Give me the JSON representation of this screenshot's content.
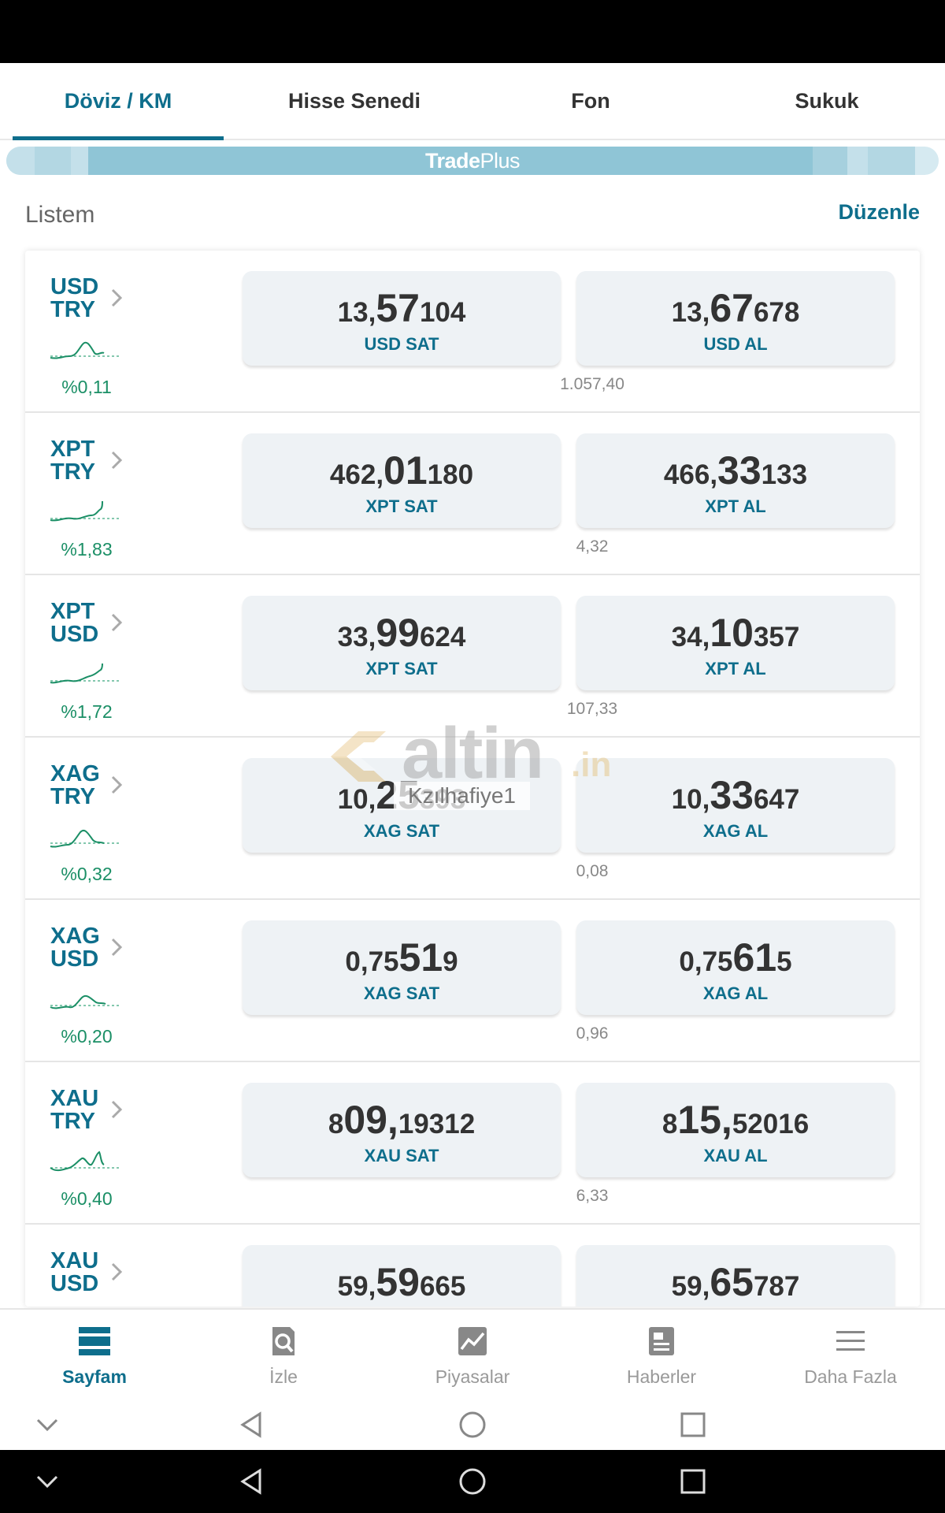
{
  "tabs": [
    {
      "label": "Döviz / KM",
      "active": true
    },
    {
      "label": "Hisse Senedi",
      "active": false
    },
    {
      "label": "Fon",
      "active": false
    },
    {
      "label": "Sukuk",
      "active": false
    }
  ],
  "banner": {
    "label_bold": "Trade",
    "label_rest": "Plus"
  },
  "section": {
    "title": "Listem",
    "edit_label": "Düzenle"
  },
  "colors": {
    "accent": "#0e6e8c",
    "positive": "#1b8f66",
    "card_bg": "#eef2f5"
  },
  "rows": [
    {
      "base": "USD",
      "quote": "TRY",
      "change": "%0,11",
      "sell": {
        "p1": "13,",
        "p2": "57",
        "p3": "104",
        "label": "USD SAT"
      },
      "buy": {
        "p1": "13,",
        "p2": "67",
        "p3": "678",
        "label": "USD AL"
      },
      "spread": "1.057,40"
    },
    {
      "base": "XPT",
      "quote": "TRY",
      "change": "%1,83",
      "sell": {
        "p1": "462,",
        "p2": "01",
        "p3": "180",
        "label": "XPT SAT"
      },
      "buy": {
        "p1": "466,",
        "p2": "33",
        "p3": "133",
        "label": "XPT AL"
      },
      "spread": "4,32"
    },
    {
      "base": "XPT",
      "quote": "USD",
      "change": "%1,72",
      "sell": {
        "p1": "33,",
        "p2": "99",
        "p3": "624",
        "label": "XPT SAT"
      },
      "buy": {
        "p1": "34,",
        "p2": "10",
        "p3": "357",
        "label": "XPT AL"
      },
      "spread": "107,33"
    },
    {
      "base": "XAG",
      "quote": "TRY",
      "change": "%0,32",
      "sell": {
        "p1": "10,",
        "p2": "25",
        "p3": "393",
        "label": "XAG SAT"
      },
      "buy": {
        "p1": "10,",
        "p2": "33",
        "p3": "647",
        "label": "XAG AL"
      },
      "spread": "0,08"
    },
    {
      "base": "XAG",
      "quote": "USD",
      "change": "%0,20",
      "sell": {
        "p1": "0,75",
        "p2": "51",
        "p3": "9",
        "label": "XAG SAT"
      },
      "buy": {
        "p1": "0,75",
        "p2": "61",
        "p3": "5",
        "label": "XAG AL"
      },
      "spread": "0,96"
    },
    {
      "base": "XAU",
      "quote": "TRY",
      "change": "%0,40",
      "sell": {
        "p1": "8",
        "p2": "09,",
        "p3": "19312",
        "label": "XAU SAT"
      },
      "buy": {
        "p1": "8",
        "p2": "15,",
        "p3": "52016",
        "label": "XAU AL"
      },
      "spread": "6,33"
    },
    {
      "base": "XAU",
      "quote": "USD",
      "change": "",
      "sell": {
        "p1": "59,",
        "p2": "59",
        "p3": "665",
        "label": ""
      },
      "buy": {
        "p1": "59,",
        "p2": "65",
        "p3": "787",
        "label": ""
      },
      "spread": ""
    }
  ],
  "watermark": {
    "brand": "altin",
    "suffix": ".in",
    "user": "Kzılhafiye1"
  },
  "bottom_nav": [
    {
      "label": "Sayfam",
      "icon": "page-icon",
      "active": true
    },
    {
      "label": "İzle",
      "icon": "watch-search-icon",
      "active": false
    },
    {
      "label": "Piyasalar",
      "icon": "markets-chart-icon",
      "active": false
    },
    {
      "label": "Haberler",
      "icon": "news-icon",
      "active": false
    },
    {
      "label": "Daha Fazla",
      "icon": "menu-icon",
      "active": false
    }
  ],
  "system_nav": {
    "icons": [
      "chevron-down-icon",
      "back-icon",
      "home-icon",
      "recents-icon"
    ]
  }
}
